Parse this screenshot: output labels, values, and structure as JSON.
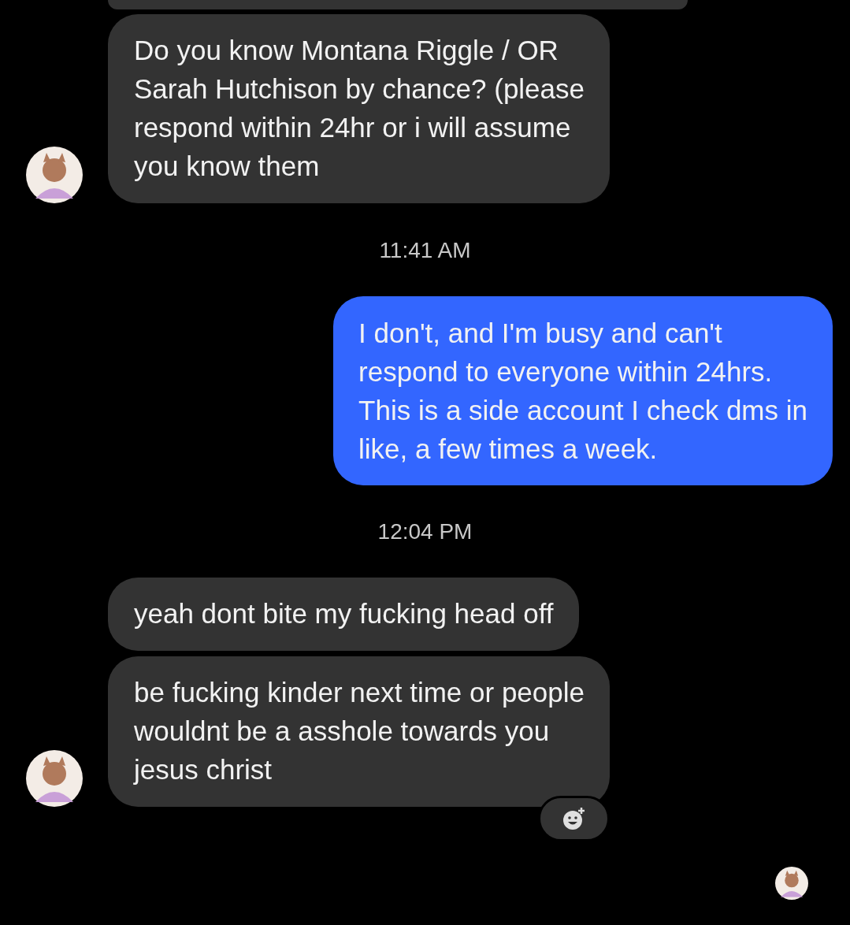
{
  "conversation": [
    {
      "kind": "partial"
    },
    {
      "kind": "incoming",
      "text": "Do you know Montana Riggle / OR\nSarah Hutchison by chance? (please\nrespond within 24hr or i will assume\nyou know them",
      "avatar": true,
      "reaction_button": false
    },
    {
      "kind": "timestamp",
      "text": "11:41 AM"
    },
    {
      "kind": "outgoing",
      "text": "I don't, and I'm busy and can't\nrespond to everyone within 24hrs.\nThis is a side account I check dms in\nlike, a few times a week.",
      "reaction_button": false
    },
    {
      "kind": "timestamp",
      "text": "12:04 PM"
    },
    {
      "kind": "incoming",
      "text": "yeah dont bite my fucking head off",
      "avatar": false,
      "reaction_button": false
    },
    {
      "kind": "incoming",
      "text": "be fucking kinder next time or people\nwouldnt be a asshole towards you\njesus christ",
      "avatar": true,
      "reaction_button": true
    }
  ],
  "read_receipt": true
}
